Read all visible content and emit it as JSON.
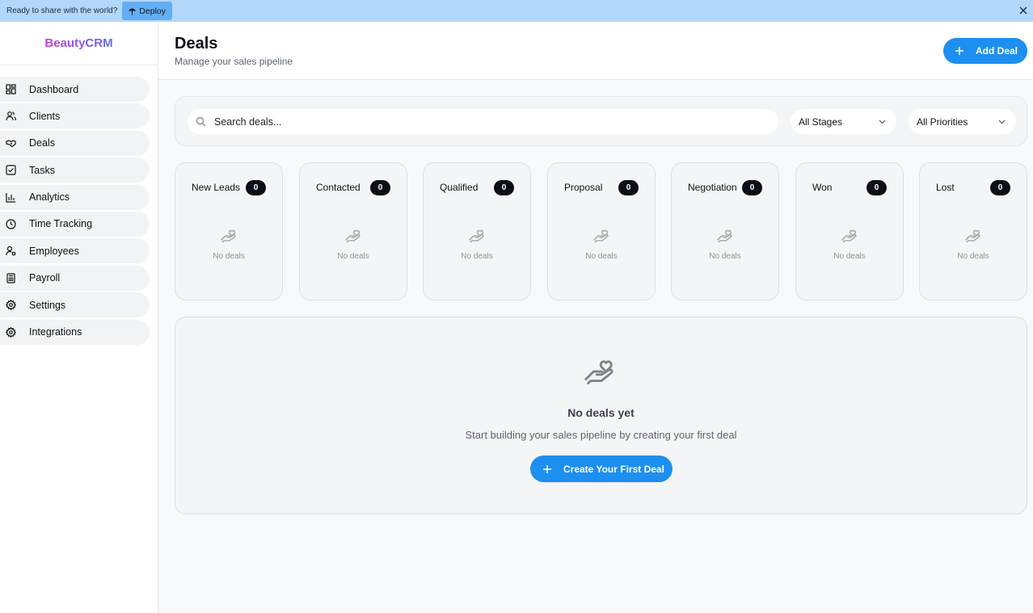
{
  "banner": {
    "text": "Ready to share with the world?",
    "deploy_label": "Deploy"
  },
  "app": {
    "name": "BeautyCRM"
  },
  "sidebar": {
    "items": [
      {
        "label": "Dashboard",
        "icon": "dashboard-grid-icon"
      },
      {
        "label": "Clients",
        "icon": "users-icon"
      },
      {
        "label": "Deals",
        "icon": "handshake-icon"
      },
      {
        "label": "Tasks",
        "icon": "check-square-icon"
      },
      {
        "label": "Analytics",
        "icon": "bar-chart-icon"
      },
      {
        "label": "Time Tracking",
        "icon": "clock-icon"
      },
      {
        "label": "Employees",
        "icon": "user-cog-icon"
      },
      {
        "label": "Payroll",
        "icon": "calculator-icon"
      },
      {
        "label": "Settings",
        "icon": "gear-icon"
      },
      {
        "label": "Integrations",
        "icon": "gear-icon"
      }
    ]
  },
  "header": {
    "title": "Deals",
    "subtitle": "Manage your sales pipeline",
    "add_label": "Add Deal"
  },
  "filters": {
    "search_placeholder": "Search deals...",
    "stage_select": "All Stages",
    "priority_select": "All Priorities"
  },
  "stages": [
    {
      "name": "New Leads",
      "count": "0",
      "empty": "No deals"
    },
    {
      "name": "Contacted",
      "count": "0",
      "empty": "No deals"
    },
    {
      "name": "Qualified",
      "count": "0",
      "empty": "No deals"
    },
    {
      "name": "Proposal",
      "count": "0",
      "empty": "No deals"
    },
    {
      "name": "Negotiation",
      "count": "0",
      "empty": "No deals"
    },
    {
      "name": "Won",
      "count": "0",
      "empty": "No deals"
    },
    {
      "name": "Lost",
      "count": "0",
      "empty": "No deals"
    }
  ],
  "empty_state": {
    "title": "No deals yet",
    "text": "Start building your sales pipeline by creating your first deal",
    "button_label": "Create Your First Deal"
  },
  "colors": {
    "accent": "#1d8ff0",
    "badge": "#0b0f17",
    "banner": "#b3d7fb"
  }
}
